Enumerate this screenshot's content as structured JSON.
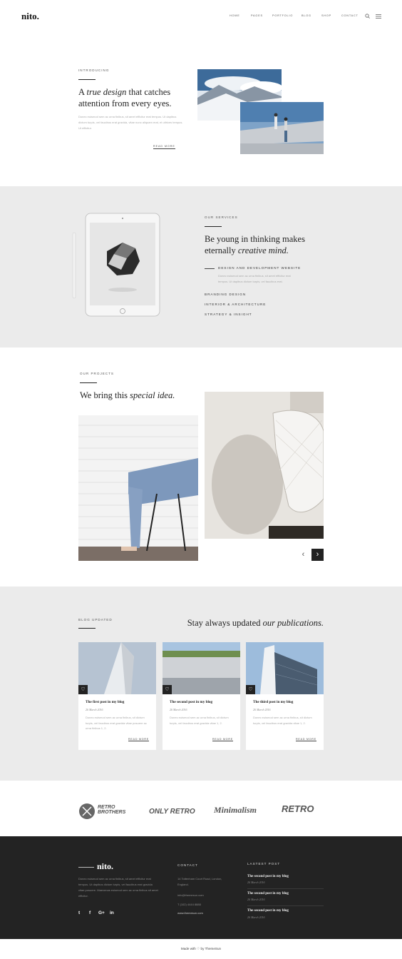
{
  "header": {
    "logo": "nito.",
    "nav": [
      "Home",
      "Pages",
      "Portfolio",
      "Blog",
      "Shop",
      "Contact"
    ],
    "icons": [
      "search-icon",
      "menu-icon"
    ]
  },
  "intro": {
    "label": "Introducing",
    "title_part1": "A ",
    "title_italic": "true design",
    "title_part2": " that catches attention from every eyes.",
    "text": "Donec euismod sem ac urna finibus, sit amet efficitur erat tempus. Ut dapibus dictum turpis, vel faucibus erat gravida, vitae nunc aliquam erat, et ultrices tempus. Ut efficitur.",
    "more": "Read more"
  },
  "services": {
    "label": "Our services",
    "title_line1": "Be young in thinking makes",
    "title_line2_plain": "eternally ",
    "title_line2_italic": "creative mind.",
    "items": [
      {
        "label": "Design and development website",
        "active": true,
        "text": "Donec euismod sem ac urna finibus, sit amet efficitur erat tempus. Ut dapibus dictum turpis, vel faucibus erat."
      },
      {
        "label": "Branding design"
      },
      {
        "label": "Interior & Architecture"
      },
      {
        "label": "Strategy & Insight"
      }
    ]
  },
  "projects": {
    "label": "Our projects",
    "title_plain": "We bring this ",
    "title_italic": "special idea.",
    "prev": "‹",
    "next": "›"
  },
  "blog": {
    "label": "Blog updated",
    "title_plain": "Stay always updated ",
    "title_italic": "our publications.",
    "posts": [
      {
        "title": "The first post in my blog",
        "date": "26 March 2016",
        "text": "Donec euismod sem ac urna finibus, sit dictum turpis, vel faucibus erat gravida vitae posuere ac urna finibus 1, 2.",
        "more": "Read more"
      },
      {
        "title": "The second post in my blog",
        "date": "26 March 2016",
        "text": "Donec euismod sem ac urna finibus, sit dictum turpis, vel faucibus erat gravida vitae 1, 2.",
        "more": "Read more"
      },
      {
        "title": "The third post in my blog",
        "date": "26 March 2016",
        "text": "Donec euismod sem ac urna finibus, sit dictum turpis, vel faucibus erat gravida vitae 1, 2.",
        "more": "Read more"
      }
    ]
  },
  "brands": [
    "RETRO BROTHERS",
    "ONLY RETRO",
    "Minimalism",
    "RETRO"
  ],
  "footer": {
    "logo": "nito.",
    "about": "Donec euismod sem ac urna finibus, sit amet efficitur erat tempus. Ut dapibus dictum turpis, vel faucibus erat gravida vitae posuere. Maecenas euismod sem ac urna finibus sit amet efficitur.",
    "contact_label": "Contact",
    "address": "14 Tottenham Court Road, London, England.",
    "email": "info@themesun.com",
    "phone": "T (102) 4444 8888",
    "website": "www.themesun.com",
    "latest_label": "Lastest post",
    "posts": [
      {
        "title": "The second post in my blog",
        "date": "26 March 2016"
      },
      {
        "title": "The second post in my blog",
        "date": "26 March 2016"
      },
      {
        "title": "The second post in my blog",
        "date": "26 March 2016"
      }
    ],
    "social": [
      "twitter-icon",
      "facebook-icon",
      "google-plus-icon",
      "linkedin-icon"
    ]
  },
  "madewith": {
    "prefix": "Made with",
    "suffix": "by ThemeSun"
  }
}
